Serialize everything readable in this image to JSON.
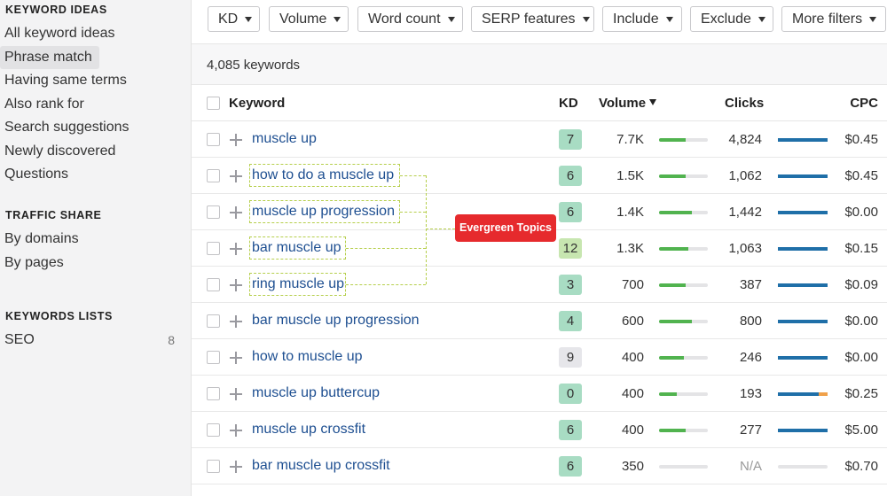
{
  "sidebar": {
    "sections": [
      {
        "heading": "KEYWORD IDEAS",
        "items": [
          {
            "label": "All keyword ideas"
          },
          {
            "label": "Phrase match",
            "active": true
          },
          {
            "label": "Having same terms"
          },
          {
            "label": "Also rank for"
          },
          {
            "label": "Search suggestions"
          },
          {
            "label": "Newly discovered"
          },
          {
            "label": "Questions"
          }
        ]
      },
      {
        "heading": "TRAFFIC SHARE",
        "items": [
          {
            "label": "By domains"
          },
          {
            "label": "By pages"
          }
        ]
      },
      {
        "heading": "KEYWORDS LISTS",
        "items": [
          {
            "label": "SEO",
            "count": "8"
          }
        ]
      }
    ]
  },
  "filters": [
    "KD",
    "Volume",
    "Word count",
    "SERP features",
    "Include",
    "Exclude",
    "More filters"
  ],
  "keyword_count": "4,085 keywords",
  "table": {
    "headers": {
      "keyword": "Keyword",
      "kd": "KD",
      "volume": "Volume",
      "clicks": "Clicks",
      "cpc": "CPC"
    },
    "rows": [
      {
        "keyword": "muscle up",
        "kd": "7",
        "kd_color": "#a8dcc3",
        "volume": "7.7K",
        "volume_fill": 0.55,
        "clicks": "4,824",
        "clicks_fill": 1.0,
        "clicks_paid": 0,
        "cpc": "$0.45"
      },
      {
        "keyword": "how to do a muscle up",
        "kd": "6",
        "kd_color": "#a8dcc3",
        "volume": "1.5K",
        "volume_fill": 0.55,
        "clicks": "1,062",
        "clicks_fill": 1.0,
        "clicks_paid": 0,
        "cpc": "$0.45"
      },
      {
        "keyword": "muscle up progression",
        "kd": "6",
        "kd_color": "#a8dcc3",
        "volume": "1.4K",
        "volume_fill": 0.68,
        "clicks": "1,442",
        "clicks_fill": 1.0,
        "clicks_paid": 0,
        "cpc": "$0.00"
      },
      {
        "keyword": "bar muscle up",
        "kd": "12",
        "kd_color": "#c7e6b0",
        "volume": "1.3K",
        "volume_fill": 0.6,
        "clicks": "1,063",
        "clicks_fill": 1.0,
        "clicks_paid": 0,
        "cpc": "$0.15"
      },
      {
        "keyword": "ring muscle up",
        "kd": "3",
        "kd_color": "#a8dcc3",
        "volume": "700",
        "volume_fill": 0.55,
        "clicks": "387",
        "clicks_fill": 1.0,
        "clicks_paid": 0,
        "cpc": "$0.09"
      },
      {
        "keyword": "bar muscle up progression",
        "kd": "4",
        "kd_color": "#a8dcc3",
        "volume": "600",
        "volume_fill": 0.68,
        "clicks": "800",
        "clicks_fill": 1.0,
        "clicks_paid": 0,
        "cpc": "$0.00"
      },
      {
        "keyword": "how to muscle up",
        "kd": "9",
        "kd_color": "#e6e6ea",
        "volume": "400",
        "volume_fill": 0.5,
        "clicks": "246",
        "clicks_fill": 1.0,
        "clicks_paid": 0,
        "cpc": "$0.00"
      },
      {
        "keyword": "muscle up buttercup",
        "kd": "0",
        "kd_color": "#a8dcc3",
        "volume": "400",
        "volume_fill": 0.37,
        "clicks": "193",
        "clicks_fill": 0.82,
        "clicks_paid": 0.18,
        "cpc": "$0.25"
      },
      {
        "keyword": "muscle up crossfit",
        "kd": "6",
        "kd_color": "#a8dcc3",
        "volume": "400",
        "volume_fill": 0.55,
        "clicks": "277",
        "clicks_fill": 1.0,
        "clicks_paid": 0,
        "cpc": "$5.00"
      },
      {
        "keyword": "bar muscle up crossfit",
        "kd": "6",
        "kd_color": "#a8dcc3",
        "volume": "350",
        "volume_fill": 0,
        "clicks": "N/A",
        "clicks_fill": 0,
        "clicks_paid": 0,
        "cpc": "$0.70"
      }
    ]
  },
  "annotation": {
    "label": "Evergreen Topics",
    "color": "#e62a2d"
  }
}
